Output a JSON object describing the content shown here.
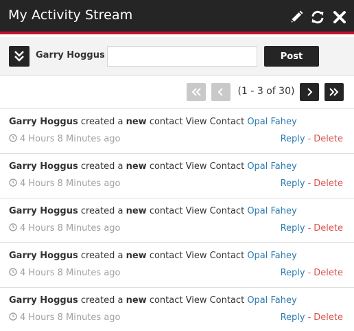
{
  "header": {
    "title": "My Activity Stream"
  },
  "icons": {
    "edit": "pencil-icon",
    "refresh": "refresh-icon",
    "close": "close-icon",
    "toggle": "double-chevron-down-icon",
    "clock": "clock-icon"
  },
  "colors": {
    "header_bg": "#252525",
    "accent_red": "#c8102e",
    "link_blue": "#2a7ab0",
    "delete_red": "#d9534f"
  },
  "postbar": {
    "user": "Garry Hoggus",
    "input_value": "",
    "post_label": "Post"
  },
  "pager": {
    "info": "(1 - 3 of 30)",
    "first_disabled": true,
    "prev_disabled": true
  },
  "feed": {
    "items": [
      {
        "actor": "Garry Hoggus",
        "verb": "created a",
        "adj": "new",
        "rest": "contact View Contact",
        "contact": "Opal Fahey",
        "time": "4 Hours 8 Minutes ago",
        "reply": "Reply",
        "sep": "-",
        "delete": "Delete"
      },
      {
        "actor": "Garry Hoggus",
        "verb": "created a",
        "adj": "new",
        "rest": "contact View Contact",
        "contact": "Opal Fahey",
        "time": "4 Hours 8 Minutes ago",
        "reply": "Reply",
        "sep": "-",
        "delete": "Delete"
      },
      {
        "actor": "Garry Hoggus",
        "verb": "created a",
        "adj": "new",
        "rest": "contact View Contact",
        "contact": "Opal Fahey",
        "time": "4 Hours 8 Minutes ago",
        "reply": "Reply",
        "sep": "-",
        "delete": "Delete"
      },
      {
        "actor": "Garry Hoggus",
        "verb": "created a",
        "adj": "new",
        "rest": "contact View Contact",
        "contact": "Opal Fahey",
        "time": "4 Hours 8 Minutes ago",
        "reply": "Reply",
        "sep": "-",
        "delete": "Delete"
      },
      {
        "actor": "Garry Hoggus",
        "verb": "created a",
        "adj": "new",
        "rest": "contact View Contact",
        "contact": "Opal Fahey",
        "time": "4 Hours 8 Minutes ago",
        "reply": "Reply",
        "sep": "-",
        "delete": "Delete"
      }
    ]
  }
}
